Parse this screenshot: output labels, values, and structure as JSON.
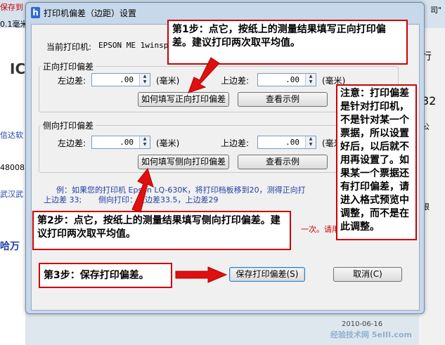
{
  "background": {
    "top_left_text": "保存到",
    "top_left_sub": "0.1毫米",
    "top_right_text": "司\"",
    "side_texts": [
      "IC",
      "信达软",
      "48008",
      "武汉武",
      "哈万",
      "IC"
    ],
    "right_texts": [
      "行",
      "32",
      "公",
      "限"
    ],
    "blue_note": "例：如果您的打印机 Epson LQ-630K，将打印档板移到20，测得正向打",
    "blue_note2": "上边差 33;",
    "blue_note3": "侧向打印：左边差33.5，上边差29",
    "red_note": "一次。请用",
    "watermark_date": "2010-06-16",
    "watermark_site": "经验技术网 5eIII.com"
  },
  "dialog": {
    "title": "打印机偏差（边距）设置",
    "icon_letter": "h",
    "current_printer_label": "当前打印机:",
    "current_printer_value": "EPSON ME 1winspo",
    "forward": {
      "legend": "正向打印偏差",
      "left_label": "左边差:",
      "left_value": ".00",
      "left_unit": "(毫米)",
      "top_label": "上边差:",
      "top_value": ".00",
      "top_unit": "(毫米)",
      "howto_button": "如何填写正向打印偏差",
      "example_button": "查看示例"
    },
    "side": {
      "legend": "侧向打印偏差",
      "left_label": "左边差:",
      "left_value": ".00",
      "left_unit": "(毫米)",
      "top_label": "上边差:",
      "top_value": ".00",
      "top_unit": "(毫米)",
      "howto_button": "如何填写侧向打印偏差",
      "example_button": "查看示例"
    },
    "save_button": "保存打印偏差(S)",
    "cancel_button": "取消(C)"
  },
  "callouts": {
    "step1": "第1步：点它，按纸上的测量结果填写正向打印偏差。建议打印两次取平均值。",
    "step2": "第2步：点它，按纸上的测量结果填写侧向打印偏差。建议打印两次取平均值。",
    "step3": "第3步：保存打印偏差。",
    "note": "注意：打印偏差是针对打印机，不是针对某一个票据，所以设置好后，以后就不用再设置了。如果某一个票据还有打印偏差，请进入格式预览中调整，而不是在此调整。"
  },
  "colors": {
    "callout_border": "#cc0000",
    "arrow": "#e01010",
    "dialog_frame": "#c7d8ea"
  }
}
